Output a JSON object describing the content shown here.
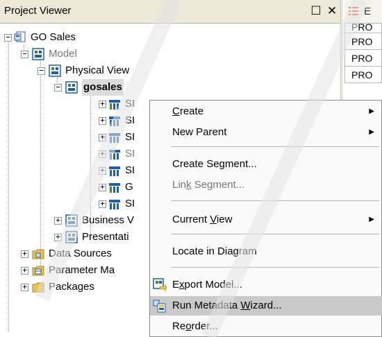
{
  "project_viewer": {
    "title": "Project Viewer",
    "maximize_glyph": "☐",
    "close_glyph": "✕"
  },
  "right_panel": {
    "tab_label": "E",
    "rows": [
      "PRO",
      "PRO",
      "PRO",
      "PRO"
    ]
  },
  "tree": {
    "root": "GO Sales",
    "model": "Model",
    "physical_view": "Physical View",
    "namespace": "gosales",
    "children": [
      "SI",
      "SI",
      "SI",
      "SI",
      "SI",
      "G",
      "SI"
    ],
    "business_view": "Business V",
    "presentation": "Presentati",
    "data_sources": "Data Sources",
    "parameter_maps": "Parameter Ma",
    "packages": "Packages"
  },
  "context_menu": {
    "create": {
      "pre": "",
      "ul": "C",
      "post": "reate"
    },
    "new_parent": "New Parent",
    "create_segment": {
      "pre": "Create Se",
      "ul": "g",
      "post": "ment..."
    },
    "link_segment": {
      "pre": "Lin",
      "ul": "k",
      "post": " Segment..."
    },
    "current_view": {
      "pre": "Current ",
      "ul": "V",
      "post": "iew"
    },
    "locate": "Locate in Diagram",
    "export_model": {
      "pre": "E",
      "ul": "x",
      "post": "port Model..."
    },
    "run_wizard": {
      "pre": "Run Metadata ",
      "ul": "W",
      "post": "izard..."
    },
    "reorder": {
      "pre": "Re",
      "ul": "o",
      "post": "rder..."
    }
  },
  "colors": {
    "menu_highlight": "#c9c9c9",
    "titlebar": "#ece9d8",
    "icon_blue": "#1f5fa8",
    "icon_green": "#3a8a3a",
    "folder_yellow": "#e8c24a"
  }
}
